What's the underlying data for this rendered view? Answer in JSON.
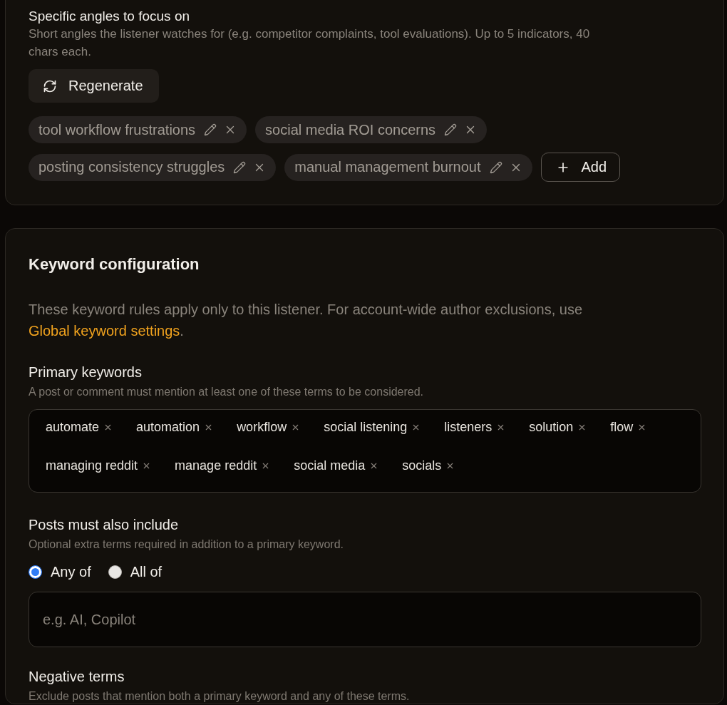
{
  "angles_section": {
    "title": "Specific angles to focus on",
    "description": "Short angles the listener watches for (e.g. competitor complaints, tool evaluations). Up to 5 indicators, 40 chars each.",
    "regenerate_button": {
      "label": "Regenerate"
    },
    "indicators": [
      "tool workflow frustrations",
      "social media ROI concerns",
      "posting consistency struggles",
      "manual management burnout"
    ],
    "add_button": {
      "label": "Add"
    }
  },
  "keyword_configuration": {
    "title": "Keyword configuration",
    "note": {
      "text": "These keyword rules apply only to this listener. For account-wide author exclusions, use ",
      "link": "Global keyword settings",
      "end": "."
    },
    "primary_keywords": {
      "label": "Primary keywords",
      "hint": "A post or comment must mention at least one of these terms to be considered.",
      "keywords": [
        "automate",
        "automation",
        "workflow",
        "social listening",
        "listeners",
        "solution",
        "flow",
        "managing reddit",
        "manage reddit",
        "social media",
        "socials"
      ]
    },
    "posts_must_also_include": {
      "label": "Posts must also include",
      "hint": "Optional extra terms required in addition to a primary keyword.",
      "match_options": [
        {
          "label": "Any of",
          "selected": true
        },
        {
          "label": "All of",
          "selected": false
        }
      ],
      "input": {
        "placeholder": "e.g. AI, Copilot"
      }
    },
    "negative_terms": {
      "label": "Negative terms",
      "hint": "Exclude posts that mention both a primary keyword and any of these terms."
    }
  }
}
